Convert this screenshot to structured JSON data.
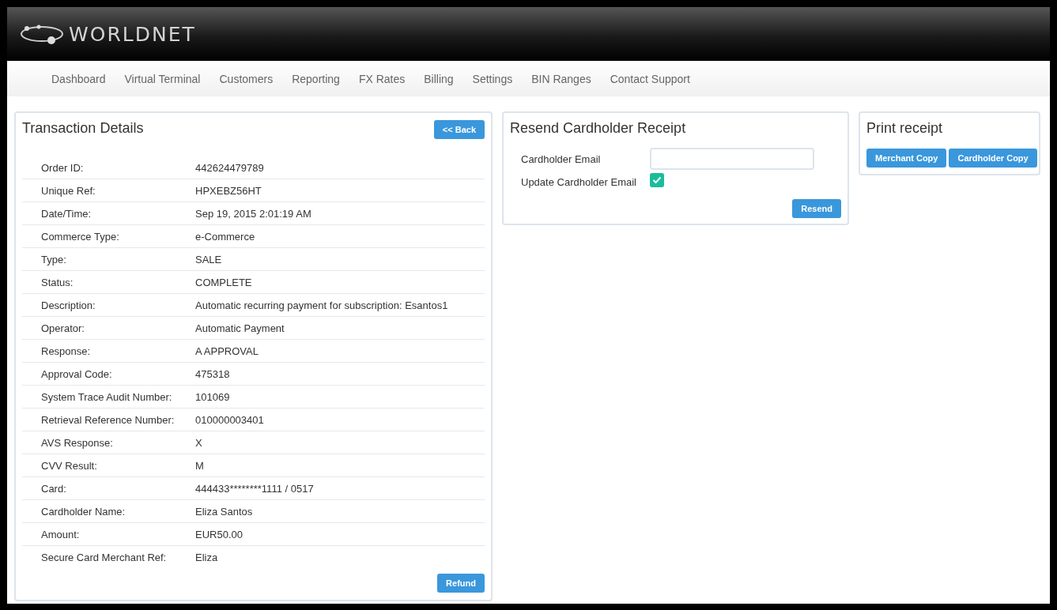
{
  "header": {
    "logo": "WORLDNET"
  },
  "nav": [
    {
      "label": "Dashboard"
    },
    {
      "label": "Virtual Terminal"
    },
    {
      "label": "Customers"
    },
    {
      "label": "Reporting"
    },
    {
      "label": "FX Rates"
    },
    {
      "label": "Billing"
    },
    {
      "label": "Settings"
    },
    {
      "label": "BIN Ranges"
    },
    {
      "label": "Contact Support"
    }
  ],
  "transaction_details": {
    "title": "Transaction Details",
    "back_button": "<< Back",
    "rows": [
      {
        "label": "Order ID:",
        "value": "442624479789"
      },
      {
        "label": "Unique Ref:",
        "value": "HPXEBZ56HT"
      },
      {
        "label": "Date/Time:",
        "value": "Sep 19, 2015 2:01:19 AM"
      },
      {
        "label": "Commerce Type:",
        "value": "e-Commerce"
      },
      {
        "label": "Type:",
        "value": "SALE"
      },
      {
        "label": "Status:",
        "value": "COMPLETE"
      },
      {
        "label": "Description:",
        "value": "Automatic recurring payment for subscription: Esantos1"
      },
      {
        "label": "Operator:",
        "value": "Automatic Payment"
      },
      {
        "label": "Response:",
        "value": "A APPROVAL"
      },
      {
        "label": "Approval Code:",
        "value": "475318"
      },
      {
        "label": "System Trace Audit Number:",
        "value": "101069"
      },
      {
        "label": "Retrieval Reference Number:",
        "value": "010000003401"
      },
      {
        "label": "AVS Response:",
        "value": "X"
      },
      {
        "label": "CVV Result:",
        "value": "M"
      },
      {
        "label": "Card:",
        "value": "444433********1111 / 0517"
      },
      {
        "label": "Cardholder Name:",
        "value": "Eliza Santos"
      },
      {
        "label": "Amount:",
        "value": "EUR50.00"
      },
      {
        "label": "Secure Card Merchant Ref:",
        "value": "Eliza"
      }
    ],
    "refund_button": "Refund"
  },
  "resend_receipt": {
    "title": "Resend Cardholder Receipt",
    "email_label": "Cardholder Email",
    "update_label": "Update Cardholder Email",
    "update_checked": true,
    "resend_button": "Resend"
  },
  "print_receipt": {
    "title": "Print receipt",
    "buttons": [
      "Merchant Copy",
      "Cardholder Copy"
    ]
  }
}
